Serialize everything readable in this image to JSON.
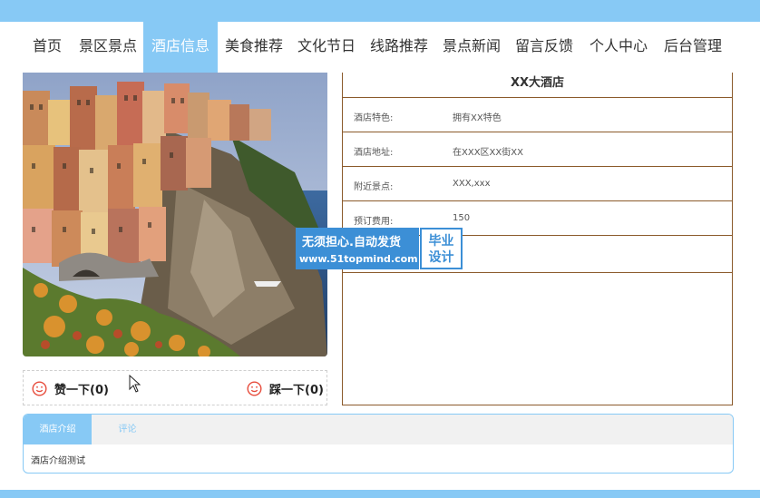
{
  "nav": {
    "items": [
      {
        "label": "首页"
      },
      {
        "label": "景区景点"
      },
      {
        "label": "酒店信息"
      },
      {
        "label": "美食推荐"
      },
      {
        "label": "文化节日"
      },
      {
        "label": "线路推荐"
      },
      {
        "label": "景点新闻"
      },
      {
        "label": "留言反馈"
      },
      {
        "label": "个人中心"
      },
      {
        "label": "后台管理"
      }
    ],
    "active": "酒店信息"
  },
  "hotel": {
    "name": "XX大酒店",
    "fields": [
      {
        "label": "酒店特色:",
        "value": "拥有XX特色"
      },
      {
        "label": "酒店地址:",
        "value": "在XXX区XX街XX"
      },
      {
        "label": "附近景点:",
        "value": "XXX,xxx"
      },
      {
        "label": "预订费用:",
        "value": "150"
      }
    ]
  },
  "votes": {
    "like_label": "赞一下(0)",
    "dislike_label": "踩一下(0)"
  },
  "watermark": {
    "line1": "无须担心.自动发货",
    "line2": "www.51topmind.com",
    "badge1": "毕业",
    "badge2": "设计"
  },
  "tabs": {
    "items": [
      {
        "label": "酒店介绍"
      },
      {
        "label": "评论"
      }
    ],
    "content": "酒店介绍测试"
  },
  "colors": {
    "accent": "#87c9f5",
    "border": "#8b5a2b",
    "watermark": "#3c8fd6",
    "smile": "#e74c3c"
  }
}
